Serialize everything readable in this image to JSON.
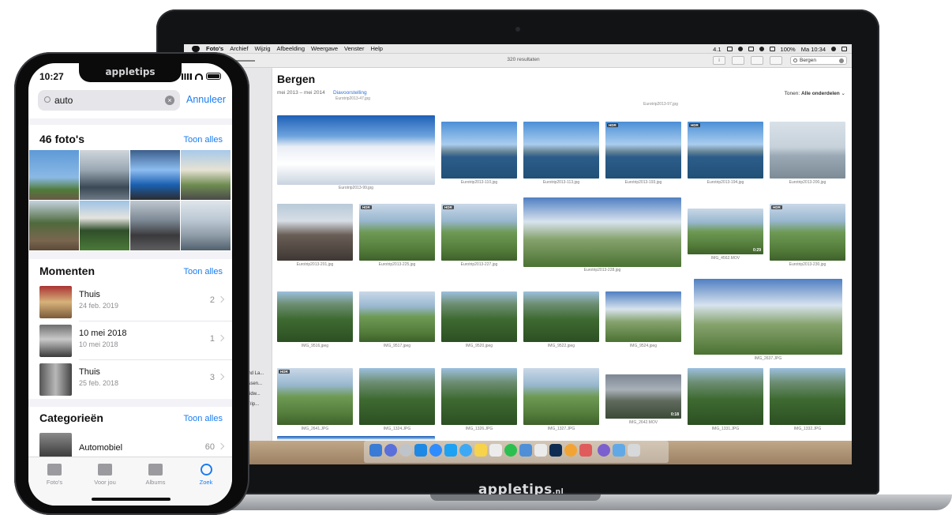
{
  "mac": {
    "menubar": {
      "items": [
        "Foto's",
        "Archief",
        "Wijzig",
        "Afbeelding",
        "Weergave",
        "Venster",
        "Help"
      ],
      "status_version": "4.1",
      "battery": "100%",
      "clock": "Ma 10:34"
    },
    "toolbar": {
      "result_count": "320 resultaten",
      "search_value": "Bergen"
    },
    "sidebar": {
      "truncated_items": [
        "end La...",
        "assen...",
        "Midw...",
        "-Trip..."
      ]
    },
    "content": {
      "title": "Bergen",
      "date_range": "mei 2013 – mei 2014",
      "slideshow_link": "Diavoorstelling",
      "show_label": "Tonen:",
      "show_value": "Alle onderdelen",
      "top_captions": [
        "Eurotrip2013-47.jpg",
        "Eurotrip2013-97.jpg"
      ],
      "photos": [
        {
          "caption": "Eurotrip2013-99.jpg",
          "hdr": ""
        },
        {
          "caption": "Eurotrip2013-110.jpg",
          "hdr": ""
        },
        {
          "caption": "Eurotrip2013-113.jpg",
          "hdr": ""
        },
        {
          "caption": "Eurotrip2013-193.jpg",
          "hdr": "HDR"
        },
        {
          "caption": "Eurotrip2013-194.jpg",
          "hdr": "HDR"
        },
        {
          "caption": "Eurotrip2013-200.jpg",
          "hdr": ""
        },
        {
          "caption": "Eurotrip2013-201.jpg",
          "hdr": ""
        },
        {
          "caption": "Eurotrip2013-225.jpg",
          "hdr": "HDR"
        },
        {
          "caption": "Eurotrip2013-227.jpg",
          "hdr": "HDR"
        },
        {
          "caption": "Eurotrip2013-228.jpg",
          "hdr": ""
        },
        {
          "caption": "IMG_4562.MOV",
          "hdr": "",
          "duration": "0:29"
        },
        {
          "caption": "Eurotrip2013-230.jpg",
          "hdr": "HDR"
        },
        {
          "caption": "IMG_9516.jpeg",
          "hdr": ""
        },
        {
          "caption": "IMG_9517.jpeg",
          "hdr": ""
        },
        {
          "caption": "IMG_9520.jpeg",
          "hdr": ""
        },
        {
          "caption": "IMG_9522.jpeg",
          "hdr": ""
        },
        {
          "caption": "IMG_9524.jpeg",
          "hdr": ""
        },
        {
          "caption": "IMG_2637.JPG",
          "hdr": ""
        },
        {
          "caption": "IMG_2641.JPG",
          "hdr": "HDR"
        },
        {
          "caption": "IMG_1324.JPG",
          "hdr": ""
        },
        {
          "caption": "IMG_1326.JPG",
          "hdr": ""
        },
        {
          "caption": "IMG_1327.JPG",
          "hdr": ""
        },
        {
          "caption": "IMG_2642.MOV",
          "hdr": "",
          "duration": "0:18"
        },
        {
          "caption": "IMG_1331.JPG",
          "hdr": ""
        },
        {
          "caption": "IMG_1332.JPG",
          "hdr": ""
        }
      ]
    },
    "chin_logo": "appletips",
    "chin_logo_suffix": ".nl"
  },
  "iphone": {
    "time": "10:27",
    "notch_logo": "appletips",
    "search_value": "auto",
    "cancel_label": "Annuleer",
    "photos_section": {
      "title": "46 foto's",
      "link": "Toon alles"
    },
    "moments_section": {
      "title": "Momenten",
      "link": "Toon alles",
      "items": [
        {
          "title": "Thuis",
          "date": "24 feb. 2019",
          "count": "2"
        },
        {
          "title": "10 mei 2018",
          "date": "10 mei 2018",
          "count": "1"
        },
        {
          "title": "Thuis",
          "date": "25 feb. 2018",
          "count": "3"
        }
      ]
    },
    "categories_section": {
      "title": "Categorieën",
      "link": "Toon alles",
      "items": [
        {
          "title": "Automobiel",
          "count": "60"
        }
      ]
    },
    "tabbar": [
      "Foto's",
      "Voor jou",
      "Albums",
      "Zoek"
    ]
  }
}
